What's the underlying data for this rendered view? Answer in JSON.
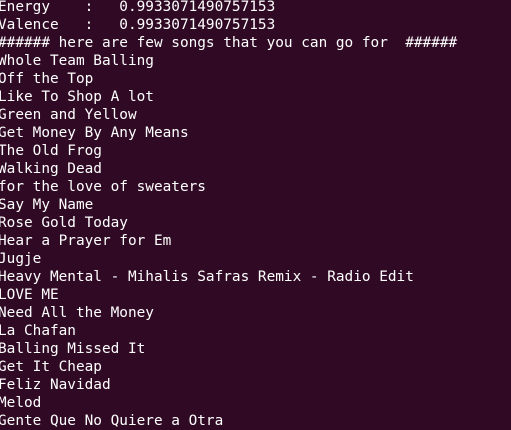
{
  "terminal": {
    "background": "#300a24",
    "foreground": "#ffffff",
    "lines": [
      "Energy    :   0.9933071490757153",
      "Valence   :   0.9933071490757153",
      "###### here are few songs that you can go for  ######",
      "Whole Team Balling",
      "Off the Top",
      "Like To Shop A lot",
      "Green and Yellow",
      "Get Money By Any Means",
      "The Old Frog",
      "Walking Dead",
      "for the love of sweaters",
      "Say My Name",
      "Rose Gold Today",
      "Hear a Prayer for Em",
      "Jugje",
      "Heavy Mental - Mihalis Safras Remix - Radio Edit",
      "LOVE ME",
      "Need All the Money",
      "La Chafan",
      "Balling Missed It",
      "Get It Cheap",
      "Feliz Navidad",
      "Melod",
      "Gente Que No Quiere a Otra"
    ]
  }
}
